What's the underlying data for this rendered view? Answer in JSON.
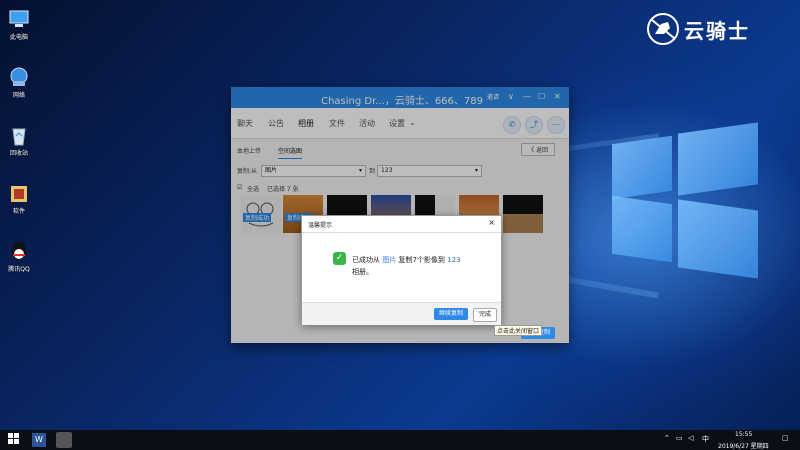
{
  "desktop": {
    "icons": [
      {
        "label": "此电脑",
        "icon": "computer-icon"
      },
      {
        "label": "网络",
        "icon": "network-icon"
      },
      {
        "label": "回收站",
        "icon": "recycle-bin-icon"
      },
      {
        "label": "软件",
        "icon": "folder-icon"
      },
      {
        "label": "腾讯QQ",
        "icon": "qq-icon"
      }
    ],
    "logo_text": "云骑士"
  },
  "window": {
    "title": "Chasing Dr...，云骑士、666、789",
    "controls": [
      "邀请",
      "∨",
      "—",
      "☐",
      "✕"
    ],
    "tabs": [
      "聊天",
      "公告",
      "相册",
      "文件",
      "活动",
      "设置"
    ],
    "active_tab": "相册",
    "subtabs": [
      "本地上传",
      "空间选图"
    ],
    "back_label": "返回",
    "copy_from_label": "复制:从",
    "copy_from_value": "图片",
    "copy_to_label": "到",
    "copy_to_value": "123",
    "select_all_label": "全选",
    "selected_count": "已选择 7 张",
    "copy_success_tag": "复制成功",
    "bottom_button": "开始复制",
    "accent": "#2d8ae6"
  },
  "dialog": {
    "title": "温馨提示",
    "message_prefix": "已成功从",
    "source": "图片",
    "message_middle": "复制7个影像到",
    "target": "123",
    "message_suffix": "相册。",
    "continue_button": "继续复制",
    "done_button": "完成"
  },
  "tooltip": "点击此关闭窗口",
  "taskbar": {
    "tray_ime": "中",
    "time": "15:55",
    "date": "2019/6/27 星期四"
  }
}
